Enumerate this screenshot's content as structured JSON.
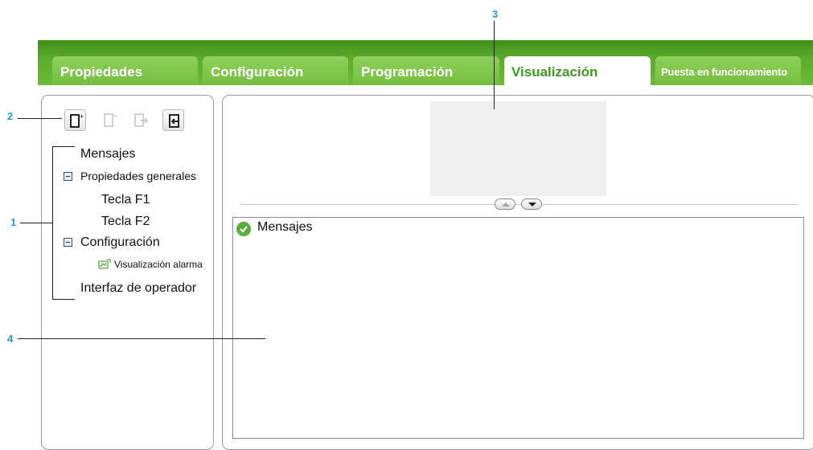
{
  "tabs": [
    {
      "label": "Propiedades"
    },
    {
      "label": "Configuración"
    },
    {
      "label": "Programación"
    },
    {
      "label": "Visualización"
    },
    {
      "label": "Puesta en funcionamiento"
    }
  ],
  "toolbar": {
    "buttons": [
      {
        "icon": "add-screen-icon",
        "enabled": true
      },
      {
        "icon": "remove-screen-icon",
        "enabled": false
      },
      {
        "icon": "export-screen-icon",
        "enabled": false
      },
      {
        "icon": "import-screen-icon",
        "enabled": true
      }
    ]
  },
  "tree": {
    "mensajes": "Mensajes",
    "propiedades_generales": "Propiedades generales",
    "tecla_f1": "Tecla F1",
    "tecla_f2": "Tecla F2",
    "configuracion": "Configuración",
    "visualizacion_alarma": "Visualización alarma",
    "interfaz_operador": "Interfaz de operador"
  },
  "messages_panel": {
    "title": "Mensajes"
  },
  "callouts": {
    "c1": "1",
    "c2": "2",
    "c3": "3",
    "c4": "4"
  },
  "colors": {
    "brand_green": "#5bab2b",
    "active_tab_text": "#3f9a1f",
    "callout": "#1ea0d2"
  }
}
